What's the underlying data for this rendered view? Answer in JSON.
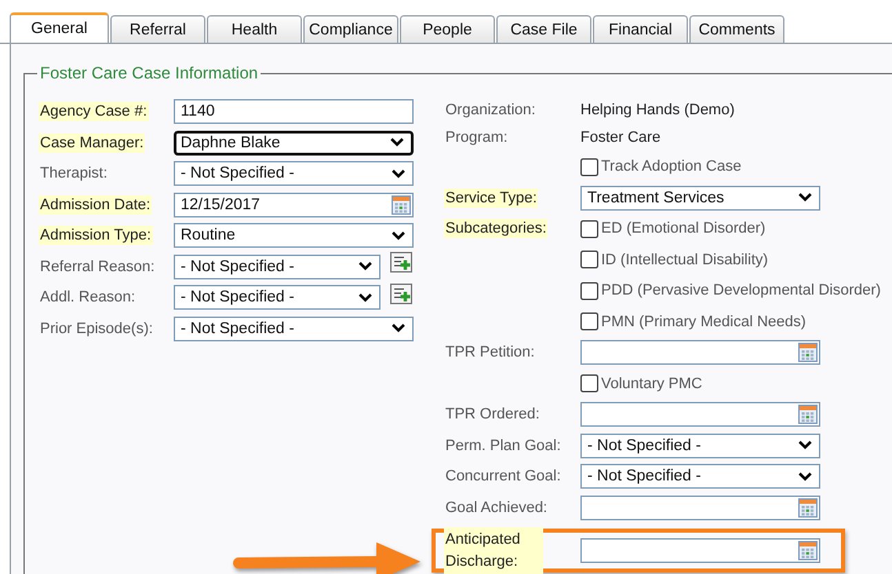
{
  "tabs": [
    {
      "label": "General",
      "selected": true
    },
    {
      "label": "Referral",
      "selected": false
    },
    {
      "label": "Health",
      "selected": false
    },
    {
      "label": "Compliance",
      "selected": false
    },
    {
      "label": "People",
      "selected": false
    },
    {
      "label": "Case File",
      "selected": false
    },
    {
      "label": "Financial",
      "selected": false
    },
    {
      "label": "Comments",
      "selected": false
    }
  ],
  "section": {
    "title": "Foster Care Case Information"
  },
  "left_fields": [
    {
      "label": "Agency Case #:",
      "required": true,
      "kind": "text",
      "value": "1140",
      "focused": false
    },
    {
      "label": "Case Manager:",
      "required": true,
      "kind": "select",
      "value": "Daphne Blake",
      "focused": true
    },
    {
      "label": "Therapist:",
      "required": false,
      "kind": "select",
      "value": "- Not Specified -",
      "focused": false
    },
    {
      "label": "Admission Date:",
      "required": true,
      "kind": "date",
      "value": "12/15/2017",
      "focused": false
    },
    {
      "label": "Admission Type:",
      "required": true,
      "kind": "select",
      "value": "Routine",
      "focused": false
    },
    {
      "label": "Referral Reason:",
      "required": false,
      "kind": "select_add",
      "value": "- Not Specified -",
      "focused": false
    },
    {
      "label": "Addl. Reason:",
      "required": false,
      "kind": "select_add",
      "value": "- Not Specified -",
      "focused": false
    },
    {
      "label": "Prior Episode(s):",
      "required": false,
      "kind": "select",
      "value": "- Not Specified -",
      "focused": false
    }
  ],
  "right_fields": [
    {
      "kind": "info",
      "label": "Organization:",
      "required": false,
      "value": "Helping Hands (Demo)",
      "highlighted": false
    },
    {
      "kind": "info",
      "label": "Program:",
      "required": false,
      "value": "Foster Care",
      "highlighted": false
    },
    {
      "kind": "checkbox",
      "text": "Track Adoption Case",
      "checked": false,
      "highlighted": false
    },
    {
      "kind": "select",
      "label": "Service Type:",
      "required": true,
      "value": "Treatment Services",
      "highlighted": false
    },
    {
      "kind": "checkbox",
      "label": "Subcategories:",
      "required": true,
      "text": "ED (Emotional Disorder)",
      "checked": false,
      "highlighted": false
    },
    {
      "kind": "checkbox",
      "text": "ID (Intellectual Disability)",
      "checked": false,
      "highlighted": false
    },
    {
      "kind": "checkbox",
      "text": "PDD (Pervasive Developmental Disorder)",
      "checked": false,
      "highlighted": false
    },
    {
      "kind": "checkbox",
      "text": "PMN (Primary Medical Needs)",
      "checked": false,
      "highlighted": false
    },
    {
      "kind": "date",
      "label": "TPR Petition:",
      "required": false,
      "highlighted": false
    },
    {
      "kind": "checkbox",
      "text": "Voluntary PMC",
      "checked": false,
      "highlighted": false
    },
    {
      "kind": "date",
      "label": "TPR Ordered:",
      "required": false,
      "highlighted": false
    },
    {
      "kind": "select",
      "label": "Perm. Plan Goal:",
      "required": false,
      "value": "- Not Specified -",
      "highlighted": false
    },
    {
      "kind": "select",
      "label": "Concurrent Goal:",
      "required": false,
      "value": "- Not Specified -",
      "highlighted": false
    },
    {
      "kind": "date",
      "label": "Goal Achieved:",
      "required": false,
      "highlighted": false
    },
    {
      "kind": "date",
      "label": "Anticipated Discharge:",
      "required": true,
      "highlighted": true
    }
  ]
}
